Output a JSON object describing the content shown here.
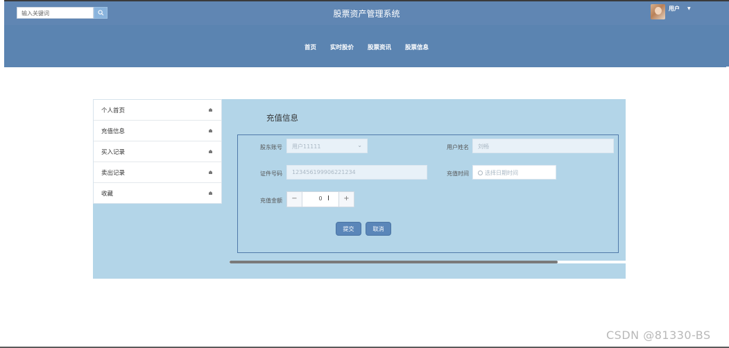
{
  "header": {
    "search_placeholder": "输入关键词",
    "site_title": "股票资产管理系统",
    "user_label": "用户",
    "nav": [
      "首页",
      "实时股价",
      "股票资讯",
      "股票信息"
    ]
  },
  "sidebar": {
    "items": [
      "个人首页",
      "充值信息",
      "买入记录",
      "卖出记录",
      "收藏"
    ]
  },
  "panel": {
    "title": "充值信息",
    "fields": {
      "account_label": "股东账号",
      "account_value": "用户11111",
      "name_label": "用户姓名",
      "name_value": "刘畅",
      "id_label": "证件号码",
      "id_value": "123456199906221234",
      "time_label": "充值时间",
      "time_placeholder": "选择日期时间",
      "amount_label": "充值金额",
      "amount_value": "0"
    },
    "submit_label": "提交",
    "cancel_label": "取消"
  },
  "watermark": "CSDN @81330-BS",
  "colors": {
    "header_bg": "#5b84b1",
    "content_bg": "#b3d5e8",
    "button_bg": "#5a86b9",
    "form_border": "#4f79a9"
  }
}
